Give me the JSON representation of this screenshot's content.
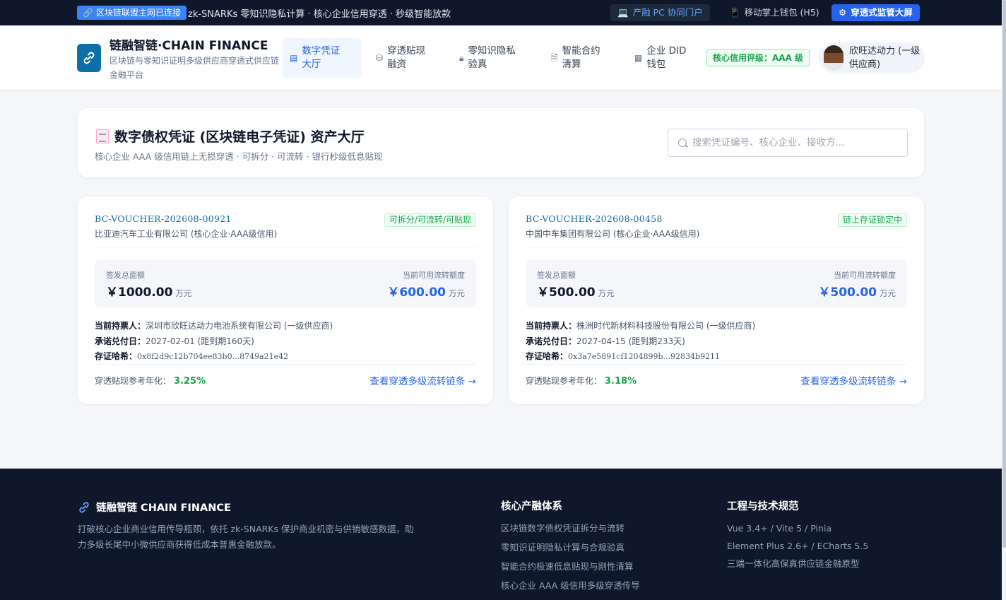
{
  "topbar": {
    "connected": "区块链联盟主网已连接",
    "ticker": "zk-SNARKs 零知识隐私计算 · 核心企业信用穿透 · 秒级智能放款",
    "links": [
      {
        "label": "产融 PC 协同门户",
        "icon": "monitor-icon"
      },
      {
        "label": "移动掌上钱包 (H5)",
        "icon": "phone-icon"
      },
      {
        "label": "穿透式监管大屏",
        "icon": "gear-icon"
      }
    ]
  },
  "header": {
    "brand_title": "链融智链·CHAIN FINANCE",
    "brand_sub": "区块链与零知识证明多级供应商穿透式供应链金融平台",
    "nav": [
      {
        "label": "数字凭证大厅",
        "icon": "document-icon",
        "active": true
      },
      {
        "label": "穿透贴现融资",
        "icon": "coins-icon",
        "active": false
      },
      {
        "label": "零知识隐私验真",
        "icon": "lock-icon",
        "active": false
      },
      {
        "label": "智能合约清算",
        "icon": "contract-icon",
        "active": false
      },
      {
        "label": "企业 DID 钱包",
        "icon": "building-icon",
        "active": false
      }
    ],
    "credit_badge": "核心信用评级：AAA 级",
    "user_name": "欣旺达动力 (一级供应商)"
  },
  "hall": {
    "title": "数字债权凭证 (区块链电子凭证) 资产大厅",
    "subtitle": "核心企业 AAA 级信用链上无损穿透 · 可拆分 · 可流转 · 银行秒级低息贴现",
    "search_placeholder": "搜索凭证编号、核心企业、接收方..."
  },
  "labels": {
    "issued_total": "签发总面额",
    "available": "当前可用流转额度",
    "unit": "万元",
    "holder": "当前持票人：",
    "due_date": "承诺兑付日：",
    "hash": "存证哈希：",
    "rate": "穿透贴现参考年化：",
    "chain_link": "查看穿透多级流转链条 →"
  },
  "vouchers": [
    {
      "code": "BC-VOUCHER-202608-00921",
      "issuer": "比亚迪汽车工业有限公司 (核心企业·AAA级信用)",
      "tag": "可拆分/可流转/可贴现",
      "total": "￥1000.00",
      "available": "￥600.00",
      "holder": "深圳市欣旺达动力电池系统有限公司 (一级供应商)",
      "due_date": "2027-02-01 (距到期160天)",
      "hash": "0x8f2d9c12b704ee83b0...8749a21e42",
      "rate": "3.25%"
    },
    {
      "code": "BC-VOUCHER-202608-00458",
      "issuer": "中国中车集团有限公司 (核心企业·AAA级信用)",
      "tag": "链上存证锁定中",
      "total": "￥500.00",
      "available": "￥500.00",
      "holder": "株洲时代新材料科技股份有限公司 (一级供应商)",
      "due_date": "2027-04-15 (距到期233天)",
      "hash": "0x3a7e5891cf1204899b...92834b9211",
      "rate": "3.18%"
    }
  ],
  "footer": {
    "brand": "链融智链 CHAIN FINANCE",
    "desc": "打破核心企业商业信用传导瓶颈，依托 zk-SNARKs 保护商业机密与供销敏感数据，助力多级长尾中小微供应商获得低成本普惠金融放款。",
    "col1_title": "核心产融体系",
    "col1_items": [
      "区块链数字债权凭证拆分与流转",
      "零知识证明隐私计算与合规验真",
      "智能合约极速低息贴现与刚性清算",
      "核心企业 AAA 级信用多级穿透传导"
    ],
    "col2_title": "工程与技术规范",
    "col2_items": [
      "Vue 3.4+ / Vite 5 / Pinia",
      "Element Plus 2.6+ / ECharts 5.5",
      "三端一体化高保真供应链金融原型"
    ]
  }
}
